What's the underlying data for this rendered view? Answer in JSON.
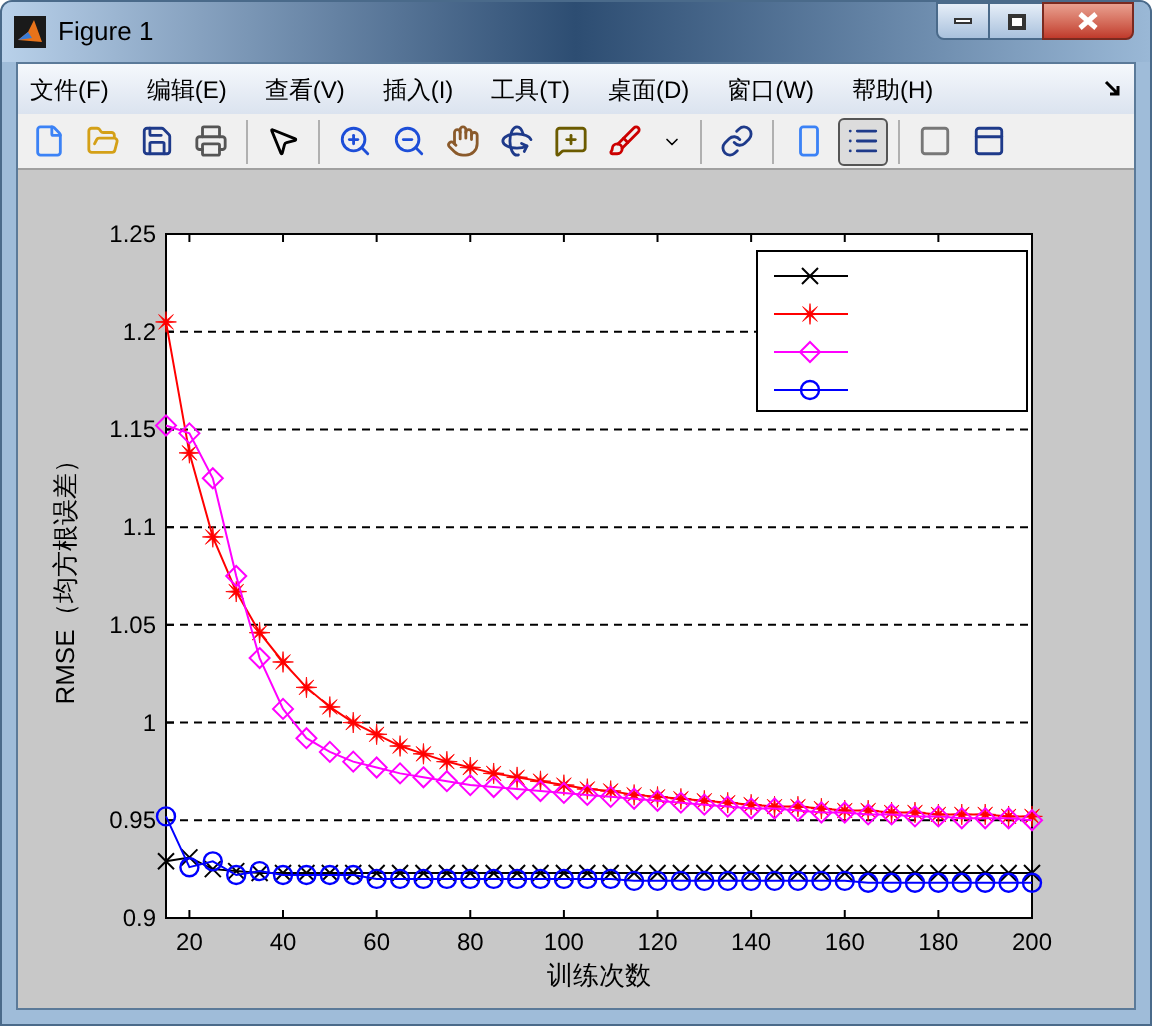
{
  "window": {
    "title": "Figure 1"
  },
  "menu": [
    "文件(F)",
    "编辑(E)",
    "查看(V)",
    "插入(I)",
    "工具(T)",
    "桌面(D)",
    "窗口(W)",
    "帮助(H)"
  ],
  "toolbar": [
    {
      "selected": false
    },
    {
      "selected": false
    },
    {
      "selected": false
    },
    {
      "selected": false
    },
    {
      "selected": false
    },
    {
      "selected": false
    },
    {
      "selected": false
    },
    {
      "selected": false
    },
    {
      "selected": false
    },
    {
      "selected": false
    },
    {
      "selected": false
    },
    {
      "selected": false
    },
    {
      "selected": false
    },
    {
      "selected": false
    },
    {
      "selected": true
    },
    {
      "selected": false
    },
    {
      "selected": false
    }
  ],
  "chart_data": {
    "type": "line",
    "grid": true,
    "xlabel": "训练次数",
    "ylabel": "RMSE（均方根误差）",
    "xlim": [
      15,
      200
    ],
    "ylim": [
      0.9,
      1.25
    ],
    "xticks": [
      20,
      40,
      60,
      80,
      100,
      120,
      140,
      160,
      180,
      200
    ],
    "yticks": [
      {
        "value": 0.9,
        "label": "0.9"
      },
      {
        "value": 0.95,
        "label": "0.95"
      },
      {
        "value": 1,
        "label": "1"
      },
      {
        "value": 1.05,
        "label": "1.05"
      },
      {
        "value": 1.1,
        "label": "1.1"
      },
      {
        "value": 1.15,
        "label": "1.15"
      },
      {
        "value": 1.2,
        "label": "1.2"
      },
      {
        "value": 1.25,
        "label": "1.25"
      }
    ],
    "x": [
      15,
      20,
      25,
      30,
      35,
      40,
      45,
      50,
      55,
      60,
      65,
      70,
      75,
      80,
      85,
      90,
      95,
      100,
      105,
      110,
      115,
      120,
      125,
      130,
      135,
      140,
      145,
      150,
      155,
      160,
      165,
      170,
      175,
      180,
      185,
      190,
      195,
      200
    ],
    "series": [
      {
        "marker": "cross",
        "color": "#000000",
        "values": [
          0.929,
          0.931,
          0.925,
          0.924,
          0.923,
          0.923,
          0.923,
          0.923,
          0.923,
          0.923,
          0.923,
          0.923,
          0.923,
          0.923,
          0.923,
          0.923,
          0.923,
          0.923,
          0.923,
          0.923,
          0.923,
          0.923,
          0.923,
          0.923,
          0.923,
          0.923,
          0.923,
          0.923,
          0.923,
          0.923,
          0.923,
          0.923,
          0.923,
          0.923,
          0.923,
          0.923,
          0.923,
          0.923
        ]
      },
      {
        "marker": "star",
        "color": "#ff0000",
        "values": [
          1.205,
          1.138,
          1.095,
          1.067,
          1.046,
          1.031,
          1.018,
          1.008,
          1.0,
          0.994,
          0.988,
          0.984,
          0.98,
          0.977,
          0.974,
          0.972,
          0.97,
          0.968,
          0.966,
          0.965,
          0.963,
          0.962,
          0.961,
          0.96,
          0.959,
          0.958,
          0.957,
          0.957,
          0.956,
          0.955,
          0.955,
          0.954,
          0.954,
          0.953,
          0.953,
          0.953,
          0.952,
          0.952
        ]
      },
      {
        "marker": "diamond",
        "color": "#ff00ff",
        "values": [
          1.152,
          1.148,
          1.125,
          1.075,
          1.033,
          1.007,
          0.992,
          0.985,
          0.98,
          0.977,
          0.974,
          0.972,
          0.97,
          0.968,
          0.967,
          0.966,
          0.965,
          0.964,
          0.963,
          0.962,
          0.961,
          0.96,
          0.959,
          0.958,
          0.957,
          0.956,
          0.956,
          0.955,
          0.954,
          0.954,
          0.953,
          0.953,
          0.952,
          0.952,
          0.951,
          0.951,
          0.951,
          0.95
        ]
      },
      {
        "marker": "circle",
        "color": "#0000ff",
        "values": [
          0.952,
          0.926,
          0.929,
          0.922,
          0.924,
          0.922,
          0.922,
          0.922,
          0.922,
          0.92,
          0.92,
          0.92,
          0.92,
          0.92,
          0.92,
          0.92,
          0.92,
          0.92,
          0.92,
          0.92,
          0.919,
          0.919,
          0.919,
          0.919,
          0.919,
          0.919,
          0.919,
          0.919,
          0.919,
          0.919,
          0.918,
          0.918,
          0.918,
          0.918,
          0.918,
          0.918,
          0.918,
          0.918
        ]
      }
    ]
  }
}
